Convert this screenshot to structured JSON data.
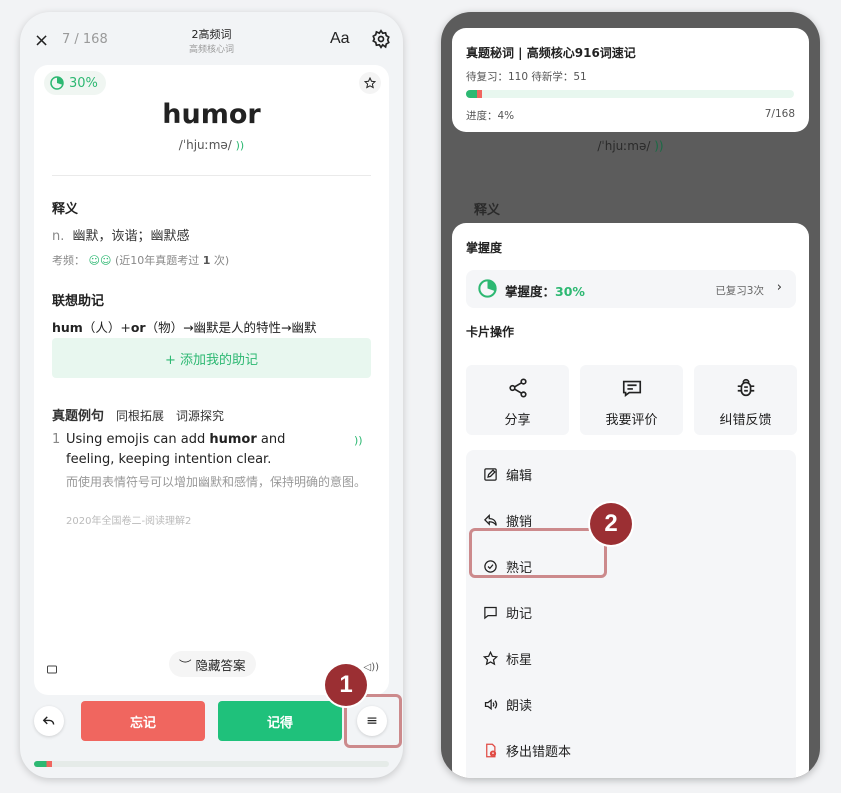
{
  "left": {
    "header": {
      "close_icon": "×",
      "progress": "7 / 168",
      "title": "2高频词",
      "subtitle": "高频核心词",
      "font_button": "Aa"
    },
    "card": {
      "mastery_pct": "30%",
      "word": "humor",
      "phonetic": "/ˈhjuːmə/",
      "sections": {
        "definition_heading": "释义",
        "pos": "n.",
        "definition": "幽默，诙谐；幽默感",
        "frequency_label": "考频：",
        "frequency_note": "(近10年真题考过 ",
        "frequency_count": "1",
        "frequency_suffix": " 次)",
        "mnemonic_heading": "联想助记",
        "mnemonic_part1": "hum",
        "mnemonic_part2": "（人）+",
        "mnemonic_part3": "or",
        "mnemonic_part4": "（物）→幽默是人的特性→幽默",
        "add_mnemonic": "+ 添加我的助记"
      },
      "tabs": [
        "真题例句",
        "同根拓展",
        "词源探究"
      ],
      "example": {
        "number": "1",
        "en_before": "Using emojis can add ",
        "en_bold": "humor",
        "en_after": " and feeling, keeping intention clear.",
        "cn": "而使用表情符号可以增加幽默和感情，保持明确的意图。",
        "source": "2020年全国卷二-阅读理解2"
      },
      "hide_answer": "隐藏答案"
    },
    "footer": {
      "forget": "忘记",
      "remember": "记得",
      "progress_fraction": 0.05
    },
    "callout_1": "1"
  },
  "right": {
    "info": {
      "title": "真题秘词 | 高频核心916词速记",
      "stats": "待复习：110  待新学：51",
      "progress_label": "进度：4%",
      "count": "7/168",
      "progress_fraction": 0.05
    },
    "background": {
      "phonetic": "/ˈhjuːmə/",
      "heading": "释义"
    },
    "sheet": {
      "mastery_heading": "掌握度",
      "mastery_label": "掌握度：",
      "mastery_value": "30%",
      "mastery_reviewed": "已复习3次",
      "ops_heading": "卡片操作",
      "ops": [
        {
          "label": "分享",
          "icon": "share-icon"
        },
        {
          "label": "我要评价",
          "icon": "comment-icon"
        },
        {
          "label": "纠错反馈",
          "icon": "bug-icon"
        }
      ],
      "menu": [
        {
          "label": "编辑",
          "icon": "edit-icon"
        },
        {
          "label": "撤销",
          "icon": "undo-icon"
        },
        {
          "label": "熟记",
          "icon": "check-circle-icon"
        },
        {
          "label": "助记",
          "icon": "message-icon"
        },
        {
          "label": "标星",
          "icon": "star-icon"
        },
        {
          "label": "朗读",
          "icon": "speaker-icon"
        },
        {
          "label": "移出错题本",
          "icon": "remove-doc-icon"
        }
      ]
    },
    "callout_2": "2"
  },
  "colors": {
    "green": "#2db872",
    "red": "#f0665f",
    "callout": "#9b2f33"
  }
}
